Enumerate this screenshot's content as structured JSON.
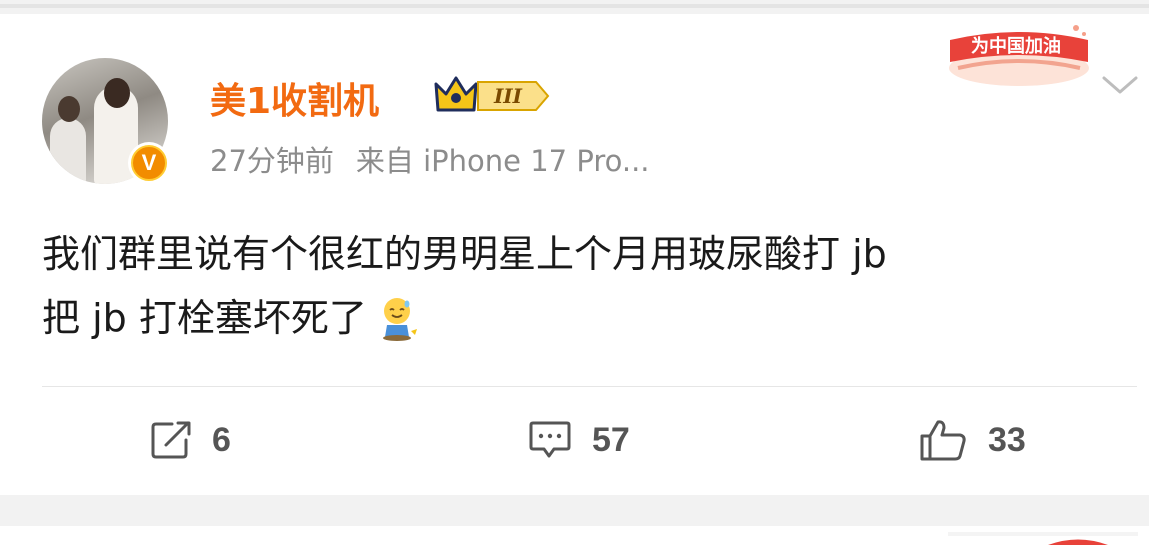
{
  "post": {
    "username": "美1收割机",
    "level_badge": "III",
    "verified_mark": "V",
    "time": "27分钟前",
    "source": "来自 iPhone 17 Pro...",
    "promo_badge": "为中国加油",
    "content_line1": "我们群里说有个很红的男明星上个月用玻尿酸打 jb",
    "content_line2": "把 jb 打栓塞坏死了",
    "emoji": "sweat-smile-kneel-emoji"
  },
  "actions": {
    "repost_count": "6",
    "comment_count": "57",
    "like_count": "33"
  },
  "colors": {
    "username": "#f26a11",
    "meta": "#8c8c8c",
    "content": "#1a1a1a",
    "background": "#f2f2f2",
    "card": "#ffffff",
    "vip_gold": "#f5b400",
    "promo_red": "#e8423a"
  }
}
